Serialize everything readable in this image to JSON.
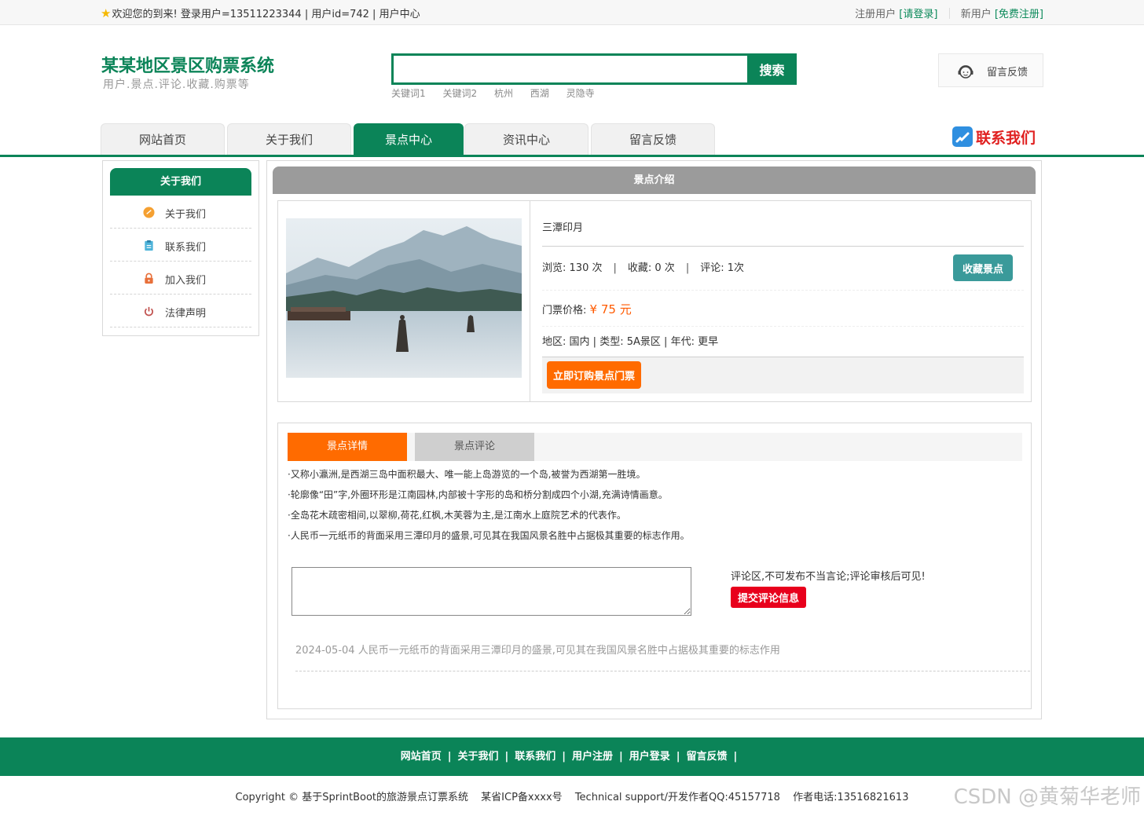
{
  "topbar": {
    "welcome": "欢迎您的到来!",
    "login_user": "登录用户=13511223344",
    "user_id": "用户id=742",
    "user_center": "用户中心",
    "registered_label": "注册用户",
    "login_link": "[请登录]",
    "new_user_label": "新用户",
    "register_link": "[免费注册]"
  },
  "header": {
    "site_title": "某某地区景区购票系统",
    "site_subtitle": "用户.景点.评论.收藏.购票等",
    "search_placeholder": "",
    "search_button": "搜索",
    "hot_keywords": [
      "关键词1",
      "关键词2",
      "杭州",
      "西湖",
      "灵隐寺"
    ],
    "feedback_label": "留言反馈"
  },
  "nav": {
    "items": [
      "网站首页",
      "关于我们",
      "景点中心",
      "资讯中心",
      "留言反馈"
    ],
    "active": "景点中心",
    "contact_us": "联系我们"
  },
  "sidebar": {
    "title": "关于我们",
    "items": [
      {
        "label": "关于我们",
        "icon": "orange-circle-icon"
      },
      {
        "label": "联系我们",
        "icon": "clipboard-icon"
      },
      {
        "label": "加入我们",
        "icon": "lock-icon"
      },
      {
        "label": "法律声明",
        "icon": "power-icon"
      }
    ]
  },
  "spot": {
    "section_title": "景点介绍",
    "name": "三潭印月",
    "views_label": "浏览:",
    "views_value": "130 次",
    "favorites_label": "收藏:",
    "favorites_value": "0 次",
    "comments_label": "评论:",
    "comments_value": "1次",
    "collect_button": "收藏景点",
    "price_label": "门票价格:",
    "price_value": "¥ 75 元",
    "region_label": "地区:",
    "region_value": "国内",
    "type_label": "类型:",
    "type_value": "5A景区",
    "era_label": "年代:",
    "era_value": "更早",
    "buy_button": "立即订购景点门票"
  },
  "details": {
    "tabs": [
      "景点详情",
      "景点评论"
    ],
    "lines": [
      "·又称小瀛洲,是西湖三岛中面积最大、唯一能上岛游览的一个岛,被誉为西湖第一胜境。",
      "·轮廓像“田”字,外圈环形是江南园林,内部被十字形的岛和桥分割成四个小湖,充满诗情画意。",
      "·全岛花木疏密相间,以翠柳,荷花,红枫,木芙蓉为主,是江南水上庭院艺术的代表作。",
      "·人民币一元纸币的背面采用三潭印月的盛景,可见其在我国风景名胜中占据极其重要的标志作用。"
    ],
    "comment_note": "评论区,不可发布不当言论;评论审核后可见!",
    "submit_button": "提交评论信息",
    "comment_date": "2024-05-04",
    "comment_text": "人民币一元纸币的背面采用三潭印月的盛景,可见其在我国风景名胜中占据极其重要的标志作用"
  },
  "footer": {
    "links": [
      "网站首页",
      "关于我们",
      "联系我们",
      "用户注册",
      "用户登录",
      "留言反馈"
    ],
    "separator": "|",
    "copyright": "Copyright © 基于SprintBoot的旅游景点订票系统",
    "icp": "某省ICP备xxxx号",
    "support": "Technical support/开发作者QQ:45157718",
    "phone": "作者电话:13516821613"
  },
  "watermark": "CSDN @黄菊华老师",
  "colors": {
    "brand_green": "#0b8458",
    "orange": "#ff6b00",
    "red": "#e8001c",
    "teal": "#3a9a9a"
  }
}
